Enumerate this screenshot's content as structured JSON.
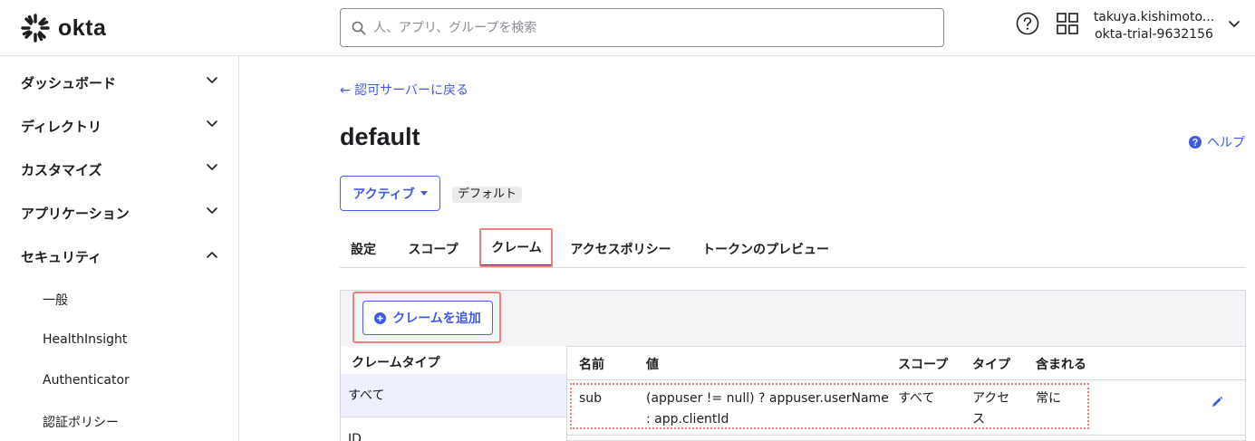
{
  "header": {
    "logo_text": "okta",
    "search_placeholder": "人、アプリ、グループを検索",
    "user_name": "takuya.kishimoto...",
    "org_name": "okta-trial-9632156"
  },
  "sidebar": {
    "items": [
      {
        "label": "ダッシュボード",
        "expanded": false
      },
      {
        "label": "ディレクトリ",
        "expanded": false
      },
      {
        "label": "カスタマイズ",
        "expanded": false
      },
      {
        "label": "アプリケーション",
        "expanded": false
      },
      {
        "label": "セキュリティ",
        "expanded": true
      }
    ],
    "security_subitems": [
      "一般",
      "HealthInsight",
      "Authenticator",
      "認証ポリシー"
    ]
  },
  "main": {
    "back_link": "← 認可サーバーに戻る",
    "title": "default",
    "help_link": "ヘルプ",
    "status_button": "アクティブ",
    "default_badge": "デフォルト",
    "tabs": [
      {
        "label": "設定",
        "active": false
      },
      {
        "label": "スコープ",
        "active": false
      },
      {
        "label": "クレーム",
        "active": true
      },
      {
        "label": "アクセスポリシー",
        "active": false
      },
      {
        "label": "トークンのプレビュー",
        "active": false
      }
    ],
    "add_claim_button": "クレームを追加",
    "claim_types": {
      "header": "クレームタイプ",
      "items": [
        "すべて",
        "ID"
      ]
    },
    "table": {
      "columns": [
        "名前",
        "値",
        "スコープ",
        "タイプ",
        "含まれる"
      ],
      "rows": [
        {
          "name": "sub",
          "value_line1": "(appuser != null) ? appuser.userName",
          "value_line2": ": app.clientId",
          "scope": "すべて",
          "type_line1": "アクセ",
          "type_line2": "ス",
          "included": "常に"
        }
      ]
    }
  },
  "colors": {
    "accent": "#3f59e4",
    "active_tab": "#8a1a7c",
    "highlight": "#ef7f7f"
  }
}
